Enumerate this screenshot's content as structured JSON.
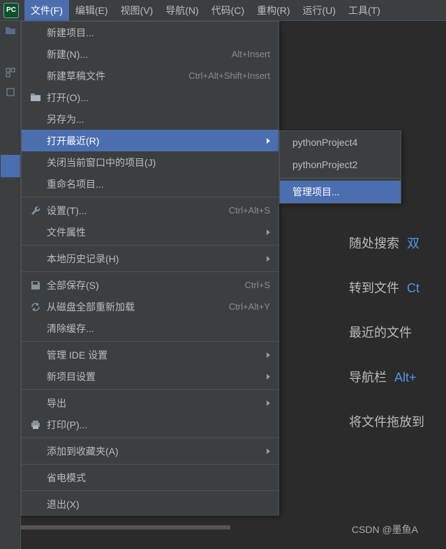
{
  "menubar": {
    "items": [
      {
        "label": "文件(F)"
      },
      {
        "label": "编辑(E)"
      },
      {
        "label": "视图(V)"
      },
      {
        "label": "导航(N)"
      },
      {
        "label": "代码(C)"
      },
      {
        "label": "重构(R)"
      },
      {
        "label": "运行(U)"
      },
      {
        "label": "工具(T)"
      }
    ]
  },
  "dropdown": {
    "items": [
      {
        "label": "新建项目...",
        "icon": "",
        "shortcut": "",
        "arrow": false
      },
      {
        "label": "新建(N)...",
        "icon": "",
        "shortcut": "Alt+Insert",
        "arrow": false
      },
      {
        "label": "新建草稿文件",
        "icon": "",
        "shortcut": "Ctrl+Alt+Shift+Insert",
        "arrow": false
      },
      {
        "label": "打开(O)...",
        "icon": "folder",
        "shortcut": "",
        "arrow": false
      },
      {
        "label": "另存为...",
        "icon": "",
        "shortcut": "",
        "arrow": false
      },
      {
        "label": "打开最近(R)",
        "icon": "",
        "shortcut": "",
        "arrow": true,
        "highlighted": true
      },
      {
        "label": "关闭当前窗口中的项目(J)",
        "icon": "",
        "shortcut": "",
        "arrow": false
      },
      {
        "label": "重命名项目...",
        "icon": "",
        "shortcut": "",
        "arrow": false
      },
      {
        "sep": true
      },
      {
        "label": "设置(T)...",
        "icon": "wrench",
        "shortcut": "Ctrl+Alt+S",
        "arrow": false
      },
      {
        "label": "文件属性",
        "icon": "",
        "shortcut": "",
        "arrow": true
      },
      {
        "sep": true
      },
      {
        "label": "本地历史记录(H)",
        "icon": "",
        "shortcut": "",
        "arrow": true
      },
      {
        "sep": true
      },
      {
        "label": "全部保存(S)",
        "icon": "save",
        "shortcut": "Ctrl+S",
        "arrow": false
      },
      {
        "label": "从磁盘全部重新加载",
        "icon": "reload",
        "shortcut": "Ctrl+Alt+Y",
        "arrow": false
      },
      {
        "label": "清除缓存...",
        "icon": "",
        "shortcut": "",
        "arrow": false
      },
      {
        "sep": true
      },
      {
        "label": "管理 IDE 设置",
        "icon": "",
        "shortcut": "",
        "arrow": true
      },
      {
        "label": "新项目设置",
        "icon": "",
        "shortcut": "",
        "arrow": true
      },
      {
        "sep": true
      },
      {
        "label": "导出",
        "icon": "",
        "shortcut": "",
        "arrow": true
      },
      {
        "label": "打印(P)...",
        "icon": "print",
        "shortcut": "",
        "arrow": false
      },
      {
        "sep": true
      },
      {
        "label": "添加到收藏夹(A)",
        "icon": "",
        "shortcut": "",
        "arrow": true
      },
      {
        "sep": true
      },
      {
        "label": "省电模式",
        "icon": "",
        "shortcut": "",
        "arrow": false
      },
      {
        "sep": true
      },
      {
        "label": "退出(X)",
        "icon": "",
        "shortcut": "",
        "arrow": false
      }
    ]
  },
  "submenu": {
    "items": [
      {
        "label": "pythonProject4"
      },
      {
        "label": "pythonProject2"
      },
      {
        "label": "管理项目...",
        "highlighted": true
      }
    ]
  },
  "content": {
    "rows": [
      {
        "text": "随处搜索",
        "link": "双"
      },
      {
        "text": "转到文件",
        "link": "Ct"
      },
      {
        "text": "最近的文件",
        "link": ""
      },
      {
        "text": "导航栏",
        "link": "Alt+"
      },
      {
        "text": "将文件拖放到",
        "link": ""
      }
    ]
  },
  "watermark": "CSDN @墨鱼A",
  "logo": "PC"
}
